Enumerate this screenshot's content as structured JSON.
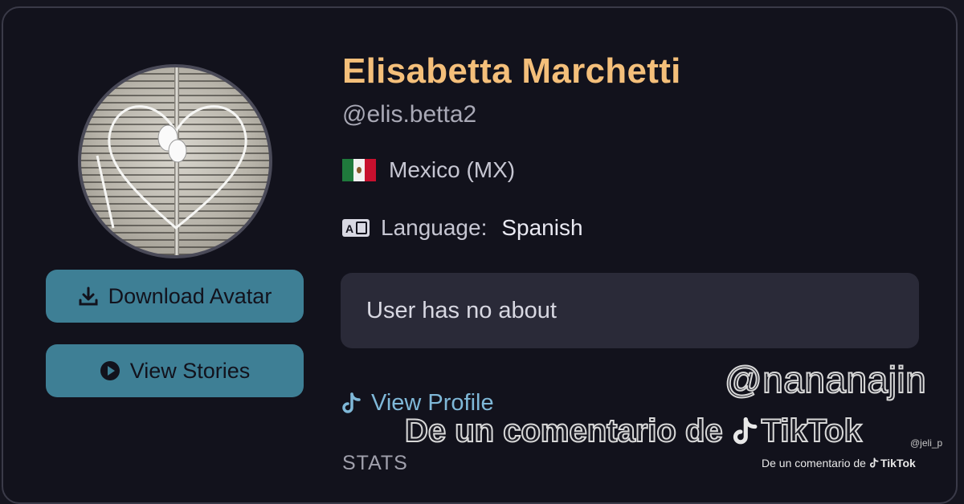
{
  "profile": {
    "name": "Elisabetta Marchetti",
    "handle": "@elis.betta2",
    "country": "Mexico (MX)",
    "language_label": "Language:",
    "language_value": "Spanish",
    "about": "User has no about"
  },
  "actions": {
    "download_avatar": "Download Avatar",
    "view_stories": "View Stories",
    "view_profile": "View Profile"
  },
  "sections": {
    "stats": "STATS"
  },
  "watermark": {
    "handle": "@nananajin",
    "line": "De un comentario de",
    "brand": "TikTok",
    "small_handle": "@jeli_p",
    "small_line": "De un comentario de",
    "small_brand": "TikTok"
  },
  "icons": {
    "download": "download-icon",
    "play": "play-circle-icon",
    "flag": "mexico-flag-icon",
    "language": "language-icon",
    "tiktok": "tiktok-icon"
  },
  "colors": {
    "name": "#f4bf7a",
    "button": "#3e7f95",
    "link": "#7fb8d8",
    "panel": "#2a2a38"
  }
}
